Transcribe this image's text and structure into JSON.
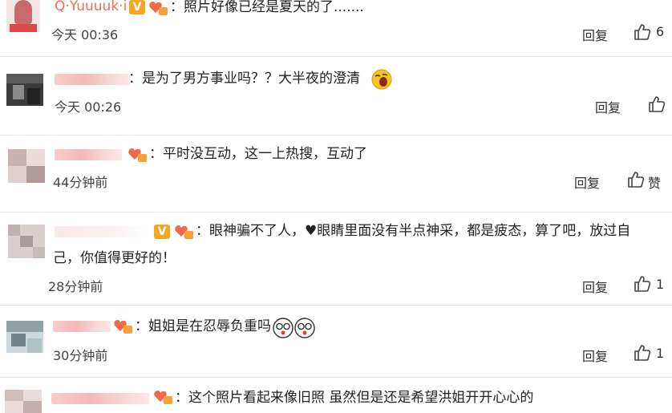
{
  "labels": {
    "reply": "回复"
  },
  "comments": [
    {
      "user": "Q·Yuuuuk·i",
      "text": "：照片好像已经是夏天的了.......",
      "time": "今天 00:36",
      "likes": "6"
    },
    {
      "user": "",
      "text": "：是为了男方事业吗？？大半夜的澄清",
      "time": "今天 00:26",
      "likes": ""
    },
    {
      "user": "",
      "text": "：平时没互动，这一上热搜，互动了",
      "time": "44分钟前",
      "likes": "赞"
    },
    {
      "user": "",
      "text_line1": "：眼神骗不了人，♥眼睛里面没有半点神采，都是疲态，算了吧，放过自",
      "text_line2": "己，你值得更好的！",
      "time": "28分钟前",
      "likes": "1"
    },
    {
      "user": "",
      "text": "：姐姐是在忍辱负重吗",
      "time": "30分钟前",
      "likes": "1"
    },
    {
      "user": "",
      "text": "：这个照片看起来像旧照 虽然但是还是希望洪姐开开心心的",
      "time": "",
      "likes": ""
    }
  ]
}
